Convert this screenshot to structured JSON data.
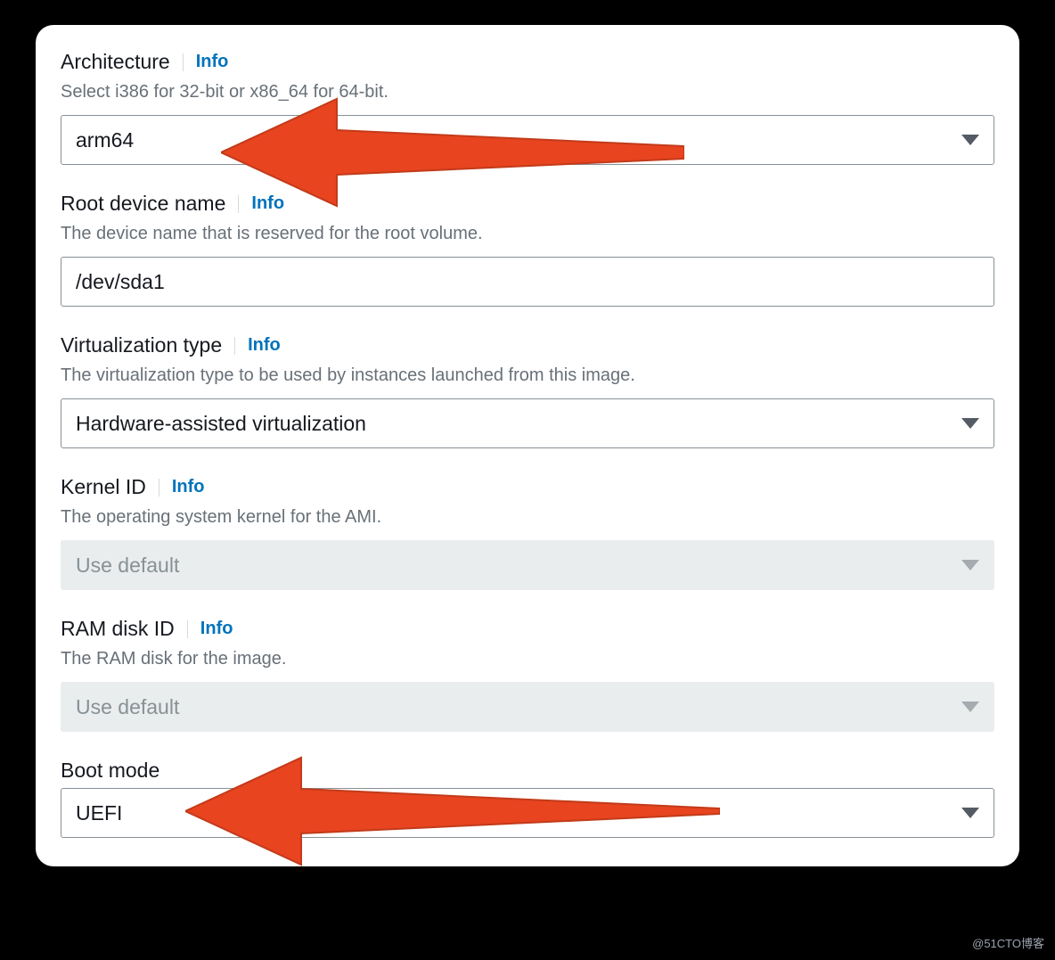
{
  "info_label": "Info",
  "fields": {
    "architecture": {
      "label": "Architecture",
      "description": "Select i386 for 32-bit or x86_64 for 64-bit.",
      "value": "arm64"
    },
    "root_device": {
      "label": "Root device name",
      "description": "The device name that is reserved for the root volume.",
      "value": "/dev/sda1"
    },
    "virtualization": {
      "label": "Virtualization type",
      "description": "The virtualization type to be used by instances launched from this image.",
      "value": "Hardware-assisted virtualization"
    },
    "kernel_id": {
      "label": "Kernel ID",
      "description": "The operating system kernel for the AMI.",
      "value": "Use default"
    },
    "ram_disk_id": {
      "label": "RAM disk ID",
      "description": "The RAM disk for the image.",
      "value": "Use default"
    },
    "boot_mode": {
      "label": "Boot mode",
      "value": "UEFI"
    }
  },
  "watermark": "@51CTO博客"
}
